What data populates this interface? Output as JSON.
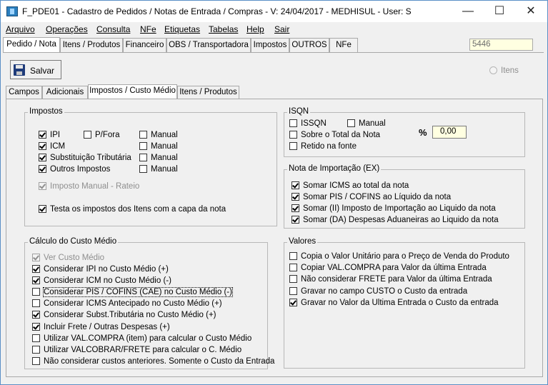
{
  "window": {
    "title": "F_PDE01 - Cadastro de Pedidos / Notas de Entrada / Compras - V: 24/04/2017 - MEDHISUL - User: S",
    "minimize": "—",
    "maximize": "☐",
    "close": "✕"
  },
  "menu": [
    "Arquivo",
    "Operações",
    "Consulta",
    "NFe",
    "Etiquetas",
    "Tabelas",
    "Help",
    "Sair"
  ],
  "main_tabs": [
    "Pedido / Nota",
    "Itens / Produtos",
    "Financeiro",
    "OBS / Transportadora",
    "Impostos",
    "OUTROS",
    "NFe"
  ],
  "doc_number": "5446",
  "toolbar": {
    "save_label": "Salvar",
    "itens_radio": "Itens"
  },
  "sub_tabs": [
    "Campos",
    "Adicionais",
    "Impostos / Custo Médio",
    "Itens / Produtos"
  ],
  "impostos": {
    "title": "Impostos",
    "ipi": "IPI",
    "pfora": "P/Fora",
    "icm": "ICM",
    "subst": "Substituição Tributária",
    "outros": "Outros Impostos",
    "manual": "Manual",
    "rateio": "Imposto Manual - Rateio",
    "testa": "Testa os impostos dos Itens com a capa da nota"
  },
  "isqn": {
    "title": "ISQN",
    "issqn": "ISSQN",
    "manual": "Manual",
    "sobre": "Sobre o Total da Nota",
    "retido": "Retido na fonte",
    "pct_label": "%",
    "pct_value": "0,00"
  },
  "importacao": {
    "title": "Nota de Importação (EX)",
    "items": [
      "Somar ICMS ao total da nota",
      "Somar PIS / COFINS ao Líquido da nota",
      "Somar (II) Imposto de Importação ao Liquido da nota",
      "Somar (DA) Despesas Aduaneiras ao Liquido da nota"
    ]
  },
  "custo": {
    "title": "Cálculo do Custo Médio",
    "items": [
      "Ver Custo Médio",
      "Considerar IPI no Custo Médio (+)",
      "Considerar ICM no Custo Médio (-)",
      "Considerar PIS / COFINS (CAE) no Custo Médio (-)",
      "Considerar ICMS Antecipado no Custo Médio (+)",
      "Considerar Subst.Tributária no Custo Médio (+)",
      "Incluir Frete / Outras Despesas (+)",
      "Utilizar VAL.COMPRA (item) para calcular o Custo Médio",
      "Utilizar VALCOBRAR/FRETE para calcular o C. Médio",
      "Não considerar custos anteriores.  Somente o Custo da Entrada"
    ]
  },
  "valores": {
    "title": "Valores",
    "items": [
      "Copia o Valor Unitário para o Preço de Venda do Produto",
      "Copiar VAL.COMPRA para Valor da última Entrada",
      "Não considerar FRETE para Valor da última Entrada",
      "Gravar no campo CUSTO o Custo da entrada",
      "Gravar no Valor da Ultima Entrada o Custo da entrada"
    ]
  }
}
